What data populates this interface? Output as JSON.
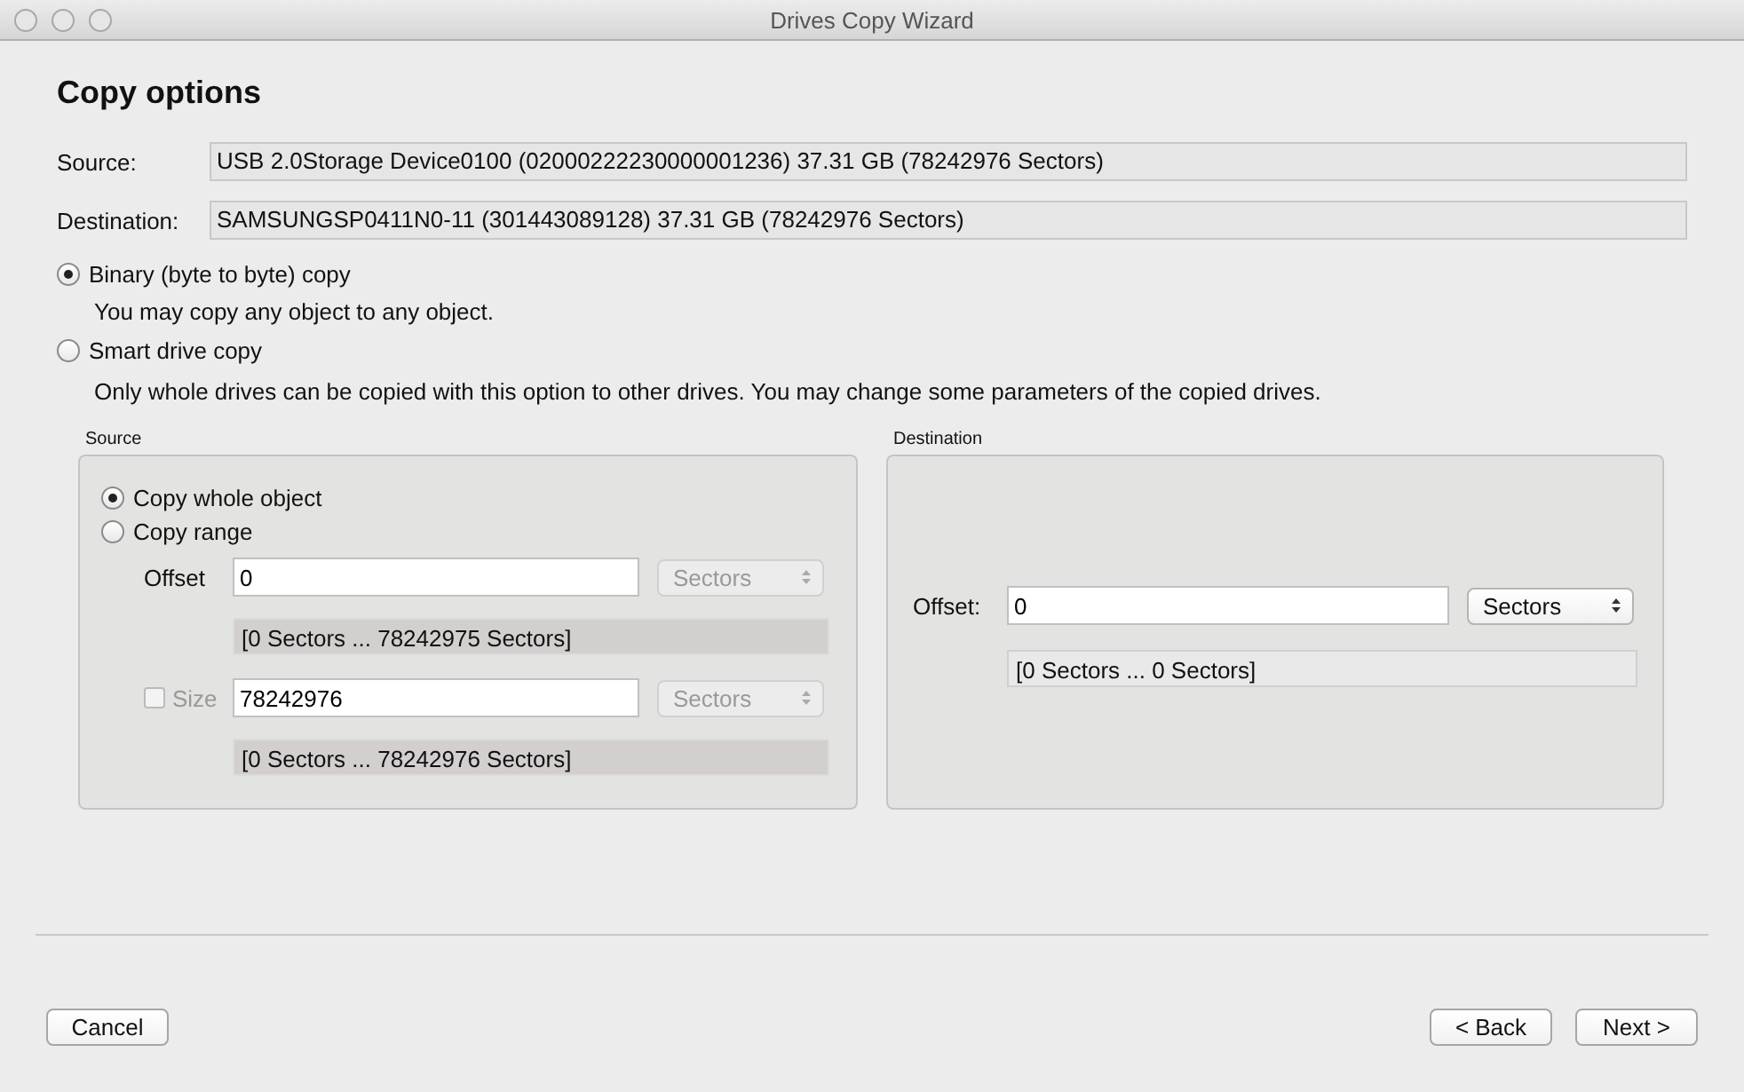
{
  "window": {
    "title": "Drives Copy Wizard"
  },
  "heading": "Copy options",
  "info_rows": [
    {
      "label": "Source:",
      "value": "USB 2.0Storage Device0100 (02000222230000001236) 37.31 GB (78242976 Sectors)"
    },
    {
      "label": "Destination:",
      "value": "SAMSUNGSP0411N0-11 (301443089128) 37.31 GB (78242976 Sectors)"
    }
  ],
  "copy_modes": [
    {
      "label": "Binary (byte to byte) copy",
      "selected": true,
      "description": "You may copy any object to any object."
    },
    {
      "label": "Smart drive copy",
      "selected": false,
      "description": "Only whole drives can be copied with this option to other drives. You may change some parameters of the copied drives."
    }
  ],
  "source_panel": {
    "title": "Source",
    "options": [
      {
        "label": "Copy whole object",
        "selected": true
      },
      {
        "label": "Copy range",
        "selected": false
      }
    ],
    "fields": [
      {
        "kind": "plain",
        "label": "Offset",
        "value": "0",
        "unit": "Sectors",
        "unit_disabled": true,
        "range": "[0 Sectors ... 78242975 Sectors]"
      },
      {
        "kind": "checkbox",
        "label": "Size",
        "checked": false,
        "value": "78242976",
        "unit": "Sectors",
        "unit_disabled": true,
        "range": "[0 Sectors ... 78242976 Sectors]"
      }
    ]
  },
  "destination_panel": {
    "title": "Destination",
    "field": {
      "label": "Offset:",
      "value": "0",
      "unit": "Sectors",
      "unit_disabled": false,
      "range": "[0 Sectors ... 0 Sectors]"
    }
  },
  "footer": {
    "left_buttons": [
      {
        "label": "Cancel"
      }
    ],
    "right_buttons": [
      {
        "label": "< Back"
      },
      {
        "label": "Next >"
      }
    ]
  }
}
